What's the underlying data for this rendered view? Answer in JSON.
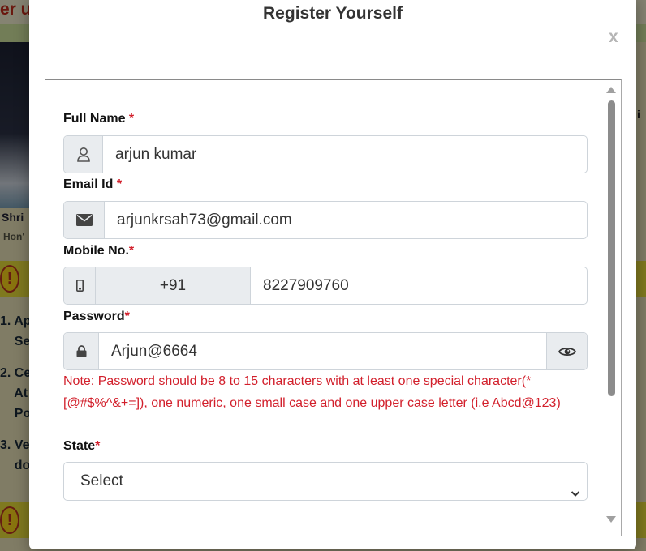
{
  "background": {
    "top_text": "er up",
    "caption_name": "Shri",
    "caption_title": "Hon'",
    "right_letter": "i",
    "list_items": [
      "1. Ap",
      "    Se",
      "2. Ce",
      "    At",
      "    Po",
      "3. Ve",
      "    do"
    ],
    "warning_icon": "!"
  },
  "modal": {
    "title": "Register Yourself",
    "close_label": "x"
  },
  "form": {
    "full_name": {
      "label": "Full Name",
      "required": "*",
      "value": "arjun kumar",
      "icon": "user-icon"
    },
    "email": {
      "label": "Email Id",
      "required": "*",
      "value": "arjunkrsah73@gmail.com",
      "icon": "envelope-icon"
    },
    "mobile": {
      "label": "Mobile No.",
      "required": "*",
      "country_code": "+91",
      "value": "8227909760",
      "icon": "mobile-icon"
    },
    "password": {
      "label": "Password",
      "required": "*",
      "value": "Arjun@6664",
      "icon": "lock-icon",
      "toggle_icon": "eye-icon",
      "note": "Note: Password should be 8 to 15 characters with at least one special character(*[@#$%^&+=]), one numeric, one small case and one upper case letter (i.e Abcd@123)"
    },
    "state": {
      "label": "State",
      "required": "*",
      "selected": "Select"
    }
  },
  "colors": {
    "required": "#d21f2b",
    "addon_bg": "#e9ecef",
    "border": "#ced4da"
  }
}
